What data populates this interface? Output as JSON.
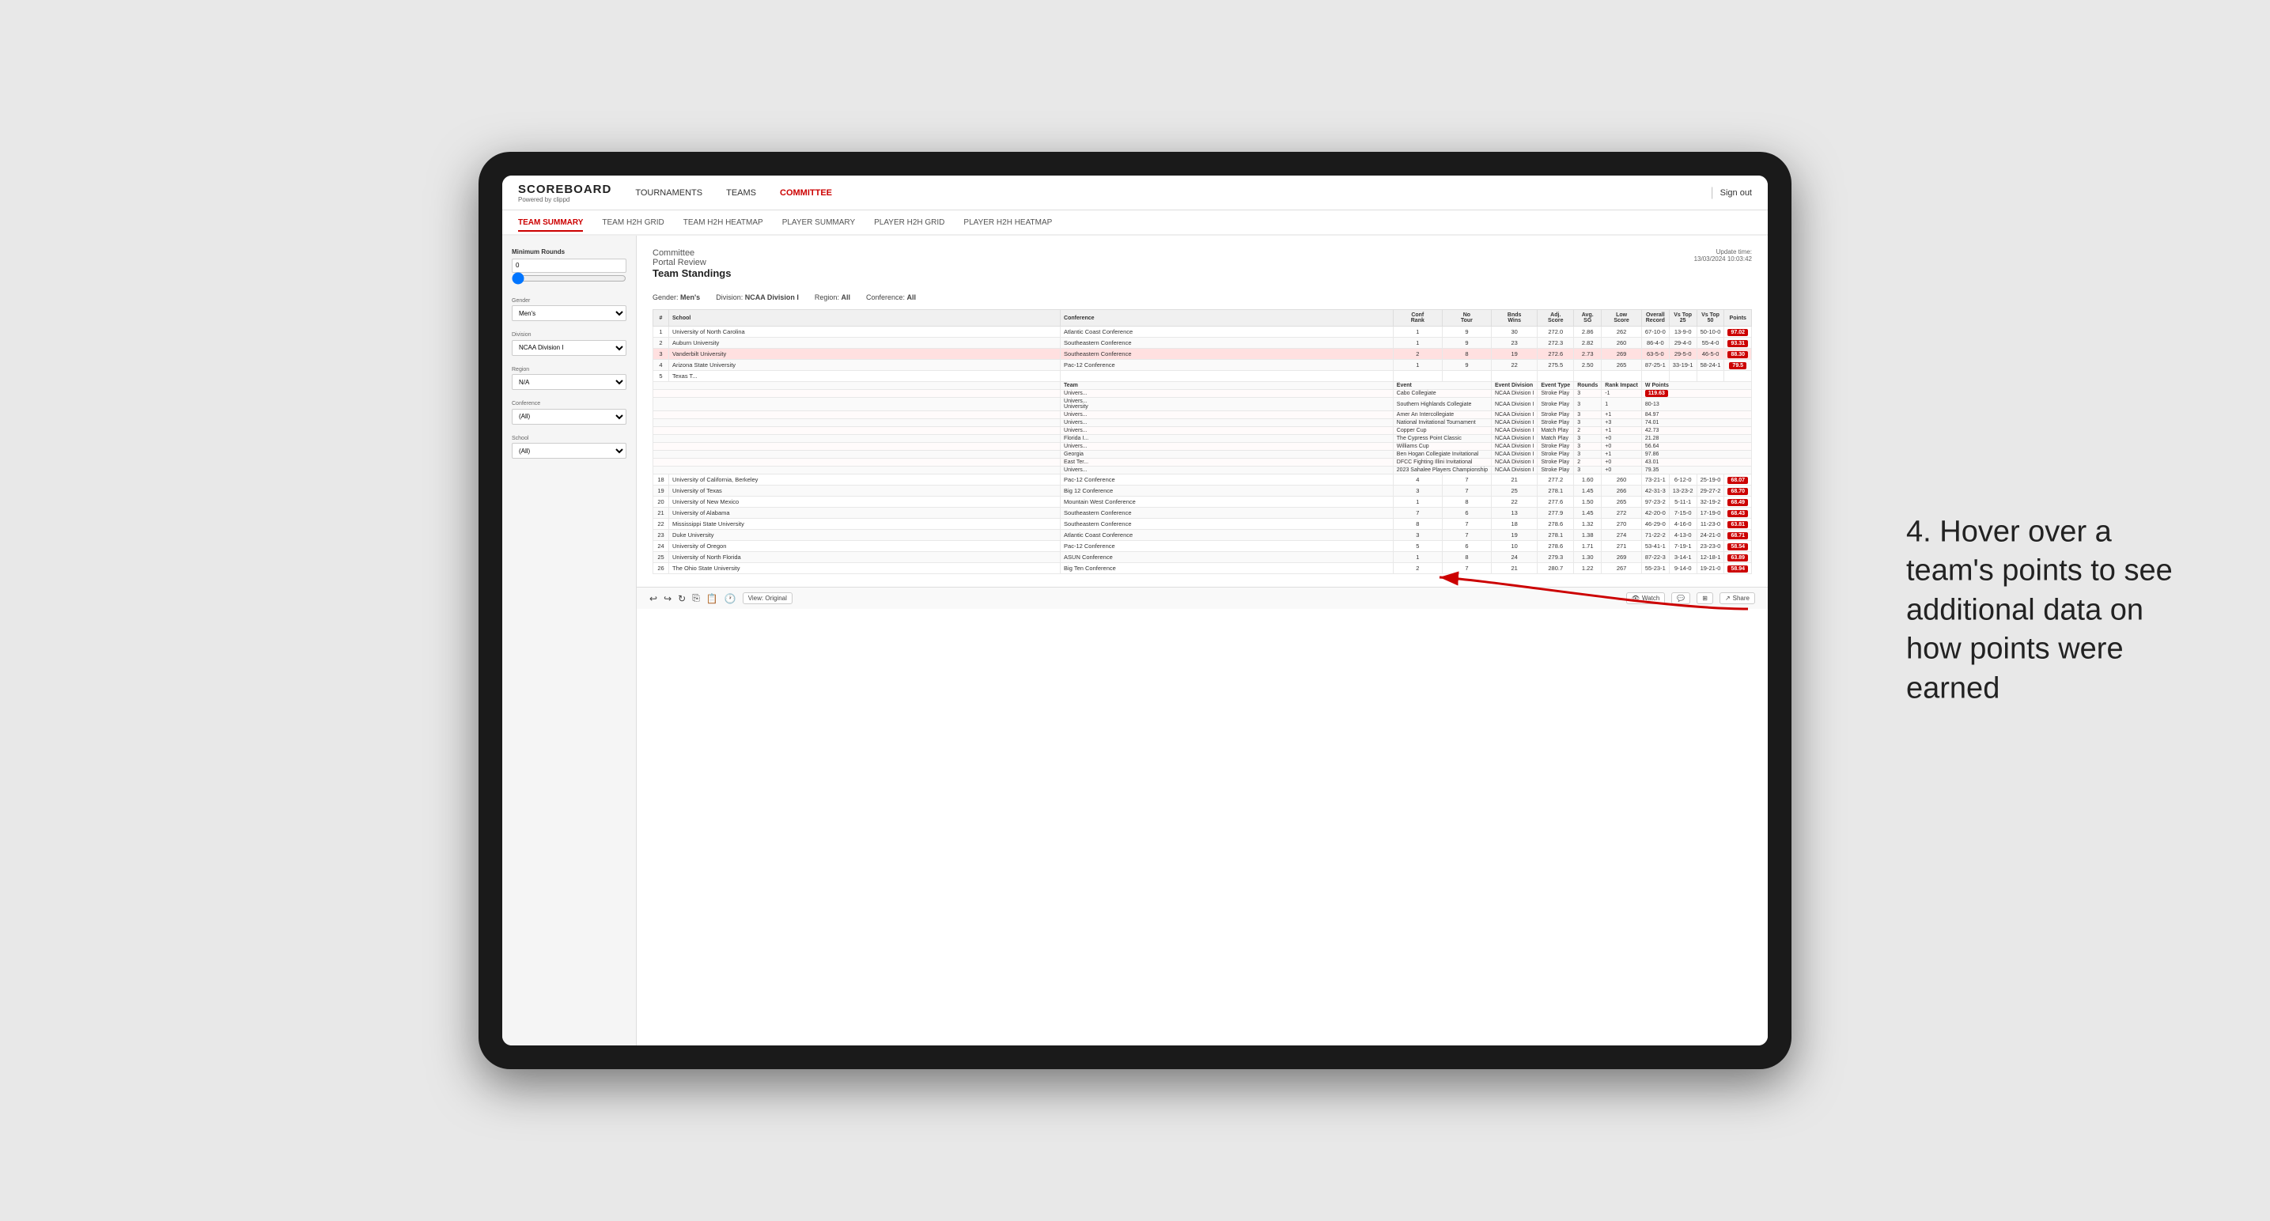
{
  "app": {
    "logo": "SCOREBOARD",
    "logo_sub": "Powered by clippd",
    "sign_out": "Sign out"
  },
  "nav": {
    "links": [
      "TOURNAMENTS",
      "TEAMS",
      "COMMITTEE"
    ],
    "active": "COMMITTEE"
  },
  "sub_nav": {
    "links": [
      "TEAM SUMMARY",
      "TEAM H2H GRID",
      "TEAM H2H HEATMAP",
      "PLAYER SUMMARY",
      "PLAYER H2H GRID",
      "PLAYER H2H HEATMAP"
    ],
    "active": "TEAM SUMMARY"
  },
  "sidebar": {
    "minimum_rounds_label": "Minimum Rounds",
    "minimum_rounds_value": "0",
    "gender_label": "Gender",
    "gender_value": "Men's",
    "division_label": "Division",
    "division_value": "NCAA Division I",
    "region_label": "Region",
    "region_value": "N/A",
    "conference_label": "Conference",
    "conference_value": "(All)",
    "school_label": "School",
    "school_value": "(All)"
  },
  "report": {
    "title": "Committee",
    "subtitle": "Portal Review",
    "section_title": "Team Standings",
    "update_label": "Update time:",
    "update_time": "13/03/2024 10:03:42",
    "filters": {
      "gender_label": "Gender:",
      "gender_value": "Men's",
      "division_label": "Division:",
      "division_value": "NCAA Division I",
      "region_label": "Region:",
      "region_value": "All",
      "conference_label": "Conference:",
      "conference_value": "All"
    },
    "table_headers": [
      "#",
      "School",
      "Conference",
      "Conf Rank",
      "No Tour",
      "Bnds Wins",
      "Adj. Score",
      "Avg. SG",
      "Low Score",
      "Overall Record",
      "Vs Top 25",
      "Vs Top 50",
      "Points"
    ],
    "rows": [
      {
        "rank": 1,
        "school": "University of North Carolina",
        "conference": "Atlantic Coast Conference",
        "conf_rank": 1,
        "no_tour": 9,
        "bnds_wins": 30,
        "adj_score": 272.0,
        "avg_sg": 2.86,
        "low_score": 262,
        "overall": "67-10-0",
        "vs25": "13-9-0",
        "vs50": "50-10-0",
        "points": "97.02",
        "highlight": false,
        "expanded": false
      },
      {
        "rank": 2,
        "school": "Auburn University",
        "conference": "Southeastern Conference",
        "conf_rank": 1,
        "no_tour": 9,
        "bnds_wins": 23,
        "adj_score": 272.3,
        "avg_sg": 2.82,
        "low_score": 260,
        "overall": "86-4-0",
        "vs25": "29-4-0",
        "vs50": "55-4-0",
        "points": "93.31",
        "highlight": false,
        "expanded": false
      },
      {
        "rank": 3,
        "school": "Vanderbilt University",
        "conference": "Southeastern Conference",
        "conf_rank": 2,
        "no_tour": 8,
        "bnds_wins": 19,
        "adj_score": 272.6,
        "avg_sg": 2.73,
        "low_score": 269,
        "overall": "63-5-0",
        "vs25": "29-5-0",
        "vs50": "46-5-0",
        "points": "88.30",
        "highlight": true,
        "expanded": false
      },
      {
        "rank": 4,
        "school": "Arizona State University",
        "conference": "Pac-12 Conference",
        "conf_rank": 1,
        "no_tour": 9,
        "bnds_wins": 22,
        "adj_score": 275.5,
        "avg_sg": 2.5,
        "low_score": 265,
        "overall": "87-25-1",
        "vs25": "33-19-1",
        "vs50": "58-24-1",
        "points": "79.5",
        "highlight": false,
        "expanded": true
      },
      {
        "rank": 5,
        "school": "Texas T...",
        "conference": "",
        "conf_rank": "",
        "no_tour": "",
        "bnds_wins": "",
        "adj_score": "",
        "avg_sg": "",
        "low_score": "",
        "overall": "",
        "vs25": "",
        "vs50": "",
        "points": "",
        "highlight": false,
        "expanded": false
      }
    ],
    "expanded_headers": [
      "Team",
      "Event",
      "Event Division",
      "Event Type",
      "Rounds",
      "Rank Impact",
      "W Points"
    ],
    "expanded_rows": [
      {
        "team": "Univers...",
        "event": "Cabo Collegiate",
        "division": "NCAA Division I",
        "type": "Stroke Play",
        "rounds": 3,
        "rank_impact": -1,
        "points": "119.63"
      },
      {
        "team": "Univers...",
        "event": "Southern Highlands Collegiate",
        "division": "NCAA Division I",
        "type": "Stroke Play",
        "rounds": 3,
        "rank_impact": 1,
        "points": "80-13"
      },
      {
        "team": "Univers...",
        "event": "Amer An Intercollegiate",
        "division": "NCAA Division I",
        "type": "Stroke Play",
        "rounds": 3,
        "rank_impact": 1,
        "points": "84.97"
      },
      {
        "team": "Univers...",
        "event": "National Invitational Tournament",
        "division": "NCAA Division I",
        "type": "Stroke Play",
        "rounds": 3,
        "rank_impact": 3,
        "points": "74.01"
      },
      {
        "team": "Univers...",
        "event": "Copper Cup",
        "division": "NCAA Division I",
        "type": "Match Play",
        "rounds": 2,
        "rank_impact": 1,
        "points": "42.73"
      },
      {
        "team": "Florida I...",
        "event": "The Cypress Point Classic",
        "division": "NCAA Division I",
        "type": "Match Play",
        "rounds": 3,
        "rank_impact": 0,
        "points": "21.28"
      },
      {
        "team": "Univers...",
        "event": "Williams Cup",
        "division": "NCAA Division I",
        "type": "Stroke Play",
        "rounds": 3,
        "rank_impact": 0,
        "points": "56.64"
      },
      {
        "team": "Georgia",
        "event": "Ben Hogan Collegiate Invitational",
        "division": "NCAA Division I",
        "type": "Stroke Play",
        "rounds": 3,
        "rank_impact": 1,
        "points": "97.86"
      },
      {
        "team": "East Ter...",
        "event": "DFCC Fighting Illini Invitational",
        "division": "NCAA Division I",
        "type": "Stroke Play",
        "rounds": 2,
        "rank_impact": 0,
        "points": "43.01"
      },
      {
        "team": "Univers...",
        "event": "2023 Sahalee Players Championship",
        "division": "NCAA Division I",
        "type": "Stroke Play",
        "rounds": 3,
        "rank_impact": 0,
        "points": "79.35"
      }
    ],
    "lower_rows": [
      {
        "rank": 18,
        "school": "University of California, Berkeley",
        "conference": "Pac-12 Conference",
        "conf_rank": 4,
        "no_tour": 7,
        "bnds_wins": 21,
        "adj_score": 277.2,
        "avg_sg": 1.6,
        "low_score": 260,
        "overall": "73-21-1",
        "vs25": "6-12-0",
        "vs50": "25-19-0",
        "points": "68.07"
      },
      {
        "rank": 19,
        "school": "University of Texas",
        "conference": "Big 12 Conference",
        "conf_rank": 3,
        "no_tour": 7,
        "bnds_wins": 25,
        "adj_score": 278.1,
        "avg_sg": 1.45,
        "low_score": 266,
        "overall": "42-31-3",
        "vs25": "13-23-2",
        "vs50": "29-27-2",
        "points": "68.70"
      },
      {
        "rank": 20,
        "school": "University of New Mexico",
        "conference": "Mountain West Conference",
        "conf_rank": 1,
        "no_tour": 8,
        "bnds_wins": 22,
        "adj_score": 277.6,
        "avg_sg": 1.5,
        "low_score": 265,
        "overall": "97-23-2",
        "vs25": "5-11-1",
        "vs50": "32-19-2",
        "points": "68.49"
      },
      {
        "rank": 21,
        "school": "University of Alabama",
        "conference": "Southeastern Conference",
        "conf_rank": 7,
        "no_tour": 6,
        "bnds_wins": 13,
        "adj_score": 277.9,
        "avg_sg": 1.45,
        "low_score": 272,
        "overall": "42-20-0",
        "vs25": "7-15-0",
        "vs50": "17-19-0",
        "points": "68.43"
      },
      {
        "rank": 22,
        "school": "Mississippi State University",
        "conference": "Southeastern Conference",
        "conf_rank": 8,
        "no_tour": 7,
        "bnds_wins": 18,
        "adj_score": 278.6,
        "avg_sg": 1.32,
        "low_score": 270,
        "overall": "46-29-0",
        "vs25": "4-16-0",
        "vs50": "11-23-0",
        "points": "63.81"
      },
      {
        "rank": 23,
        "school": "Duke University",
        "conference": "Atlantic Coast Conference",
        "conf_rank": 3,
        "no_tour": 7,
        "bnds_wins": 19,
        "adj_score": 278.1,
        "avg_sg": 1.38,
        "low_score": 274,
        "overall": "71-22-2",
        "vs25": "4-13-0",
        "vs50": "24-21-0",
        "points": "68.71"
      },
      {
        "rank": 24,
        "school": "University of Oregon",
        "conference": "Pac-12 Conference",
        "conf_rank": 5,
        "no_tour": 6,
        "bnds_wins": 10,
        "adj_score": 278.6,
        "avg_sg": 1.71,
        "low_score": 271,
        "overall": "53-41-1",
        "vs25": "7-19-1",
        "vs50": "23-23-0",
        "points": "58.54"
      },
      {
        "rank": 25,
        "school": "University of North Florida",
        "conference": "ASUN Conference",
        "conf_rank": 1,
        "no_tour": 8,
        "bnds_wins": 24,
        "adj_score": 279.3,
        "avg_sg": 1.3,
        "low_score": 269,
        "overall": "87-22-3",
        "vs25": "3-14-1",
        "vs50": "12-18-1",
        "points": "63.89"
      },
      {
        "rank": 26,
        "school": "The Ohio State University",
        "conference": "Big Ten Conference",
        "conf_rank": 2,
        "no_tour": 7,
        "bnds_wins": 21,
        "adj_score": 280.7,
        "avg_sg": 1.22,
        "low_score": 267,
        "overall": "55-23-1",
        "vs25": "9-14-0",
        "vs50": "19-21-0",
        "points": "58.94"
      }
    ]
  },
  "toolbar": {
    "view_label": "View: Original",
    "watch_label": "Watch",
    "share_label": "Share"
  },
  "annotation": {
    "text": "4. Hover over a team's points to see additional data on how points were earned"
  }
}
